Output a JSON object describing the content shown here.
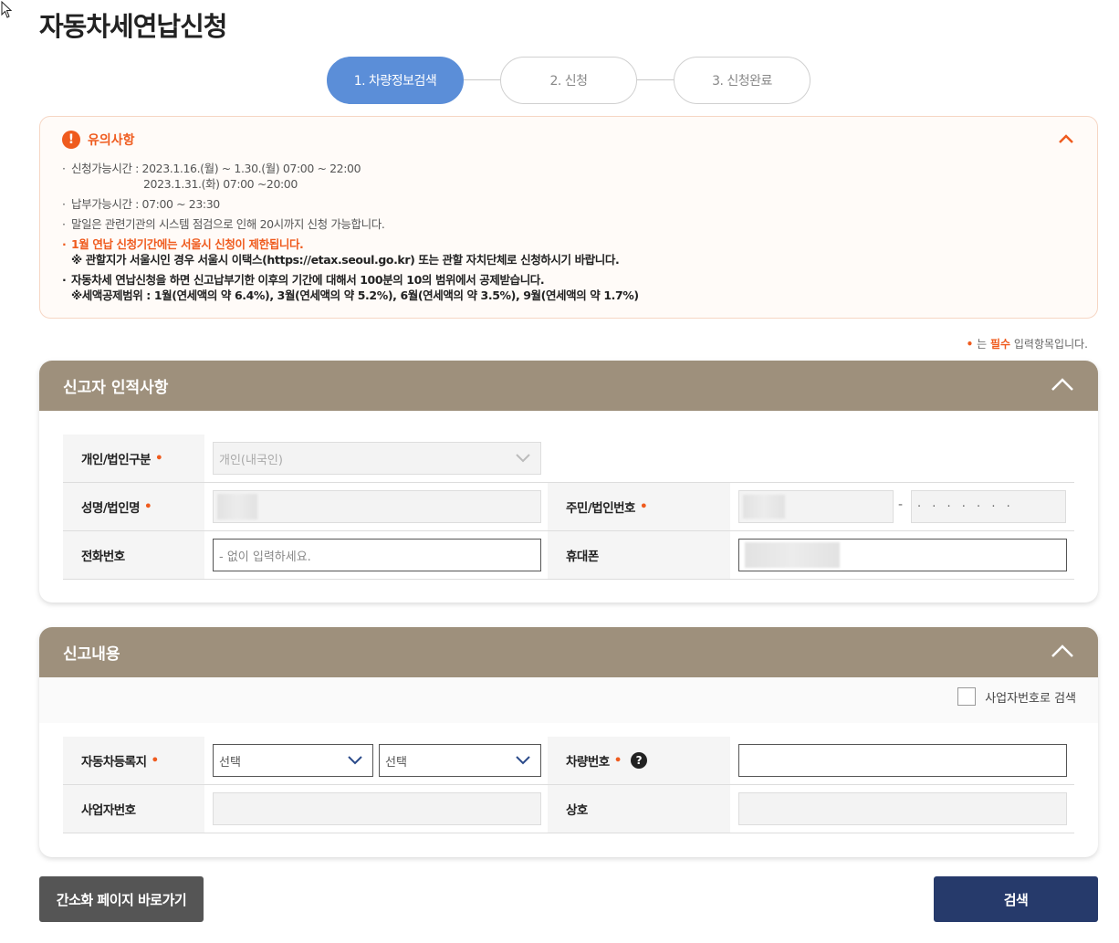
{
  "page": {
    "title": "자동차세연납신청"
  },
  "steps": [
    {
      "label": "1. 차량정보검색",
      "active": true
    },
    {
      "label": "2. 신청",
      "active": false
    },
    {
      "label": "3. 신청완료",
      "active": false
    }
  ],
  "notice": {
    "title": "유의사항",
    "line1": "신청가능시간 : 2023.1.16.(월) ~ 1.30.(월) 07:00 ~ 22:00",
    "line1_sub": "2023.1.31.(화) 07:00 ~20:00",
    "line2": "납부가능시간 : 07:00 ~ 23:30",
    "line3": "말일은 관련기관의 시스템 점검으로 인해 20시까지 신청 가능합니다.",
    "line4": "1월 연납 신청기간에는 서울시 신청이 제한됩니다.",
    "line4_sub": "※ 관할지가 서울시인 경우 서울시 이택스(https://etax.seoul.go.kr) 또는 관할 자치단체로 신청하시기 바랍니다.",
    "line5": "자동차세 연납신청을 하면 신고납부기한 이후의 기간에 대해서 100분의 10의 범위에서 공제받습니다.",
    "line5_sub": "※세액공제범위 : 1월(연세액의 약 6.4%), 3월(연세액의 약 5.2%), 6월(연세액의 약 3.5%), 9월(연세액의 약 1.7%)"
  },
  "required_note": {
    "dot": "•",
    "prefix": "는 ",
    "req": "필수",
    "suffix": " 입력항목입니다."
  },
  "reporter": {
    "title": "신고자 인적사항",
    "type_label": "개인/법인구분",
    "type_value": "개인(내국인)",
    "name_label": "성명/법인명",
    "id_label": "주민/법인번호",
    "id_dash": "-",
    "id_mask": "· · · · · · ·",
    "phone_label": "전화번호",
    "phone_placeholder": "- 없이 입력하세요.",
    "mobile_label": "휴대폰",
    "required_mark": "•"
  },
  "report": {
    "title": "신고내용",
    "checkbox_label": "사업자번호로 검색",
    "region_label": "자동차등록지",
    "select1": "선택",
    "select2": "선택",
    "car_no_label": "차량번호",
    "help": "?",
    "biz_no_label": "사업자번호",
    "company_label": "상호",
    "required_mark": "•"
  },
  "buttons": {
    "simple": "간소화 페이지 바로가기",
    "search": "검색"
  },
  "colors": {
    "accent": "#5b8ed8",
    "warning": "#ef5b1e",
    "panel_header": "#9e907c",
    "navy": "#263a6b"
  }
}
